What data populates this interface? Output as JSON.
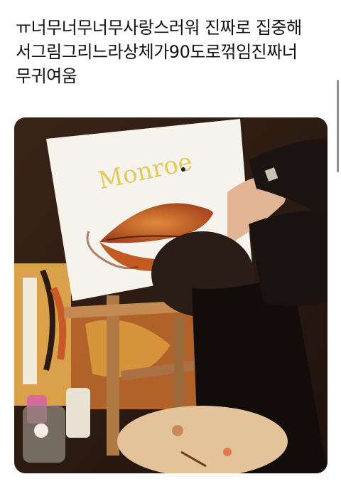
{
  "post": {
    "text_lines": [
      "ㅠ너무너무너무사랑스러워 진짜로 집중해",
      "서그림그리느라상체가90도로꺾임진짜너",
      "무귀여움"
    ]
  },
  "photo": {
    "canvas_lettering": "Monroe",
    "icons": {
      "photo": "photo-icon"
    }
  },
  "colors": {
    "text": "#111111",
    "background": "#ffffff",
    "scrollbar": "#8e8e8e"
  }
}
